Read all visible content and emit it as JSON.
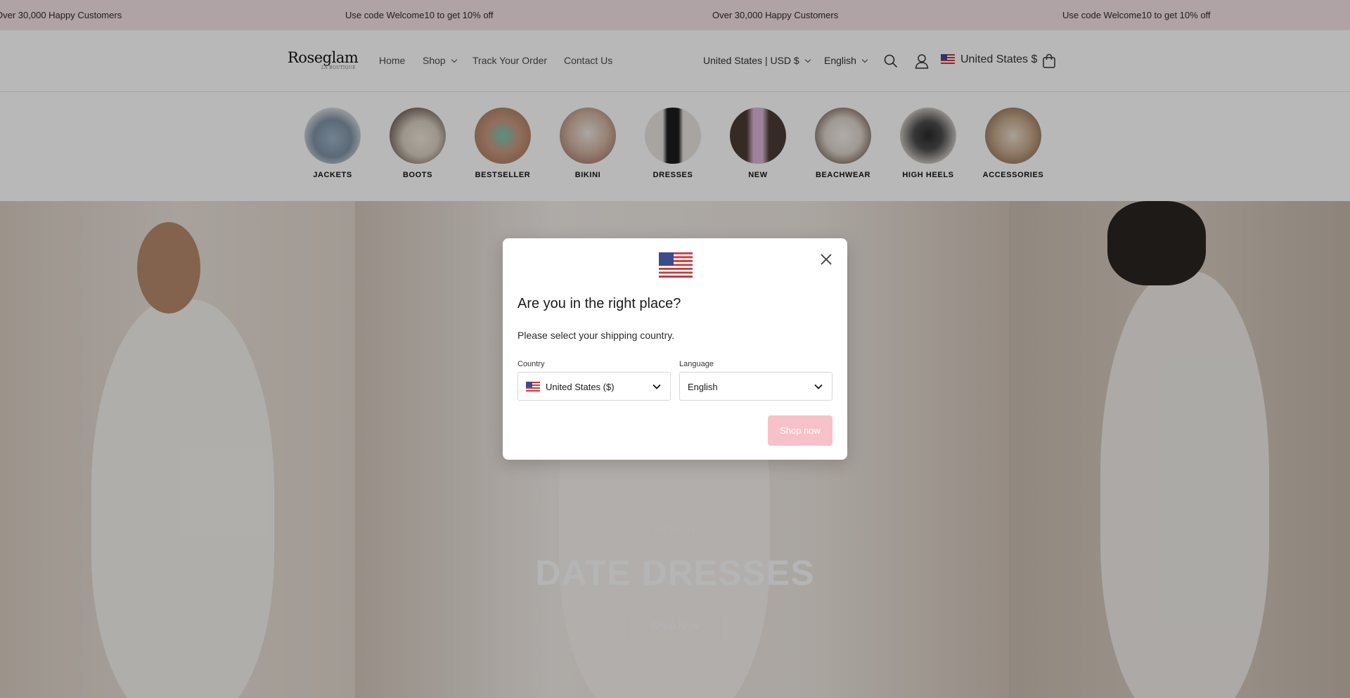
{
  "announcement": {
    "items": [
      "Over 30,000 Happy Customers",
      "Use code Welcome10 to get 10% off",
      "Over 30,000 Happy Customers",
      "Use code Welcome10 to get 10% off"
    ]
  },
  "header": {
    "logo_text": "Roseglam",
    "logo_tagline": "LA BOUTIQUE",
    "nav": [
      "Home",
      "Shop",
      "Track Your Order",
      "Contact Us"
    ],
    "currency_selector": "United States | USD $",
    "language_selector": "English",
    "country_display": "United States $",
    "icons": [
      "search-icon",
      "account-icon",
      "us-flag-icon",
      "cart-icon"
    ]
  },
  "categories": [
    "JACKETS",
    "BOOTS",
    "BESTSELLER",
    "BIKINI",
    "DRESSES",
    "NEW",
    "BEACHWEAR",
    "HIGH HEELS",
    "ACCESSORIES"
  ],
  "hero": {
    "eyebrow": "NEW IN",
    "title": "DATE DRESSES",
    "button": "Shop Now"
  },
  "modal": {
    "title": "Are you in the right place?",
    "subtitle": "Please select your shipping country.",
    "country_label": "Country",
    "country_value": "United States ($)",
    "language_label": "Language",
    "language_value": "English",
    "submit": "Shop now",
    "submit_color": "#f7c1c8"
  },
  "colors": {
    "announcement_bg": "#f4e2e6",
    "accent": "#f7c1c8"
  }
}
